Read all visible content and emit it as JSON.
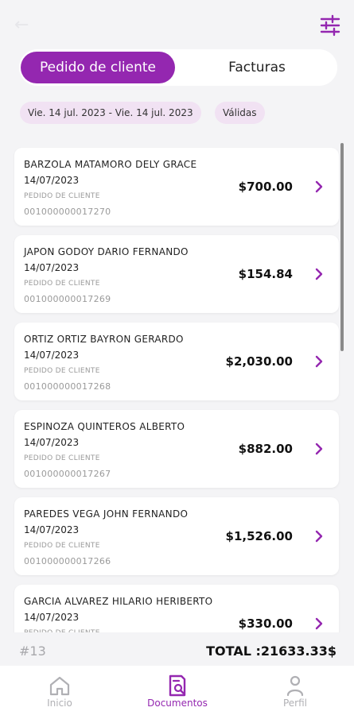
{
  "header": {
    "back_icon": "back-arrow-icon",
    "filter_icon": "sliders-icon"
  },
  "tabs": [
    {
      "label": "Pedido de cliente",
      "active": true
    },
    {
      "label": "Facturas",
      "active": false
    }
  ],
  "filters": {
    "date_range": "Vie. 14 jul. 2023 - Vie. 14 jul. 2023",
    "status": "Válidas"
  },
  "orders": [
    {
      "name": "BARZOLA MATAMORO DELY GRACE",
      "date": "14/07/2023",
      "type": "PEDIDO DE CLIENTE",
      "number": "001000000017270",
      "amount": "$700.00"
    },
    {
      "name": "JAPON GODOY DARIO FERNANDO",
      "date": "14/07/2023",
      "type": "PEDIDO DE CLIENTE",
      "number": "001000000017269",
      "amount": "$154.84"
    },
    {
      "name": "ORTIZ ORTIZ BAYRON GERARDO",
      "date": "14/07/2023",
      "type": "PEDIDO DE CLIENTE",
      "number": "001000000017268",
      "amount": "$2,030.00"
    },
    {
      "name": "ESPINOZA QUINTEROS ALBERTO",
      "date": "14/07/2023",
      "type": "PEDIDO DE CLIENTE",
      "number": "001000000017267",
      "amount": "$882.00"
    },
    {
      "name": "PAREDES VEGA JOHN FERNANDO",
      "date": "14/07/2023",
      "type": "PEDIDO DE CLIENTE",
      "number": "001000000017266",
      "amount": "$1,526.00"
    },
    {
      "name": "GARCIA ALVAREZ HILARIO HERIBERTO",
      "date": "14/07/2023",
      "type": "PEDIDO DE CLIENTE",
      "number": "",
      "amount": "$330.00"
    }
  ],
  "summary": {
    "count": "#13",
    "total": "TOTAL :21633.33$"
  },
  "nav": [
    {
      "label": "Inicio",
      "icon": "home-icon",
      "active": false
    },
    {
      "label": "Documentos",
      "icon": "document-search-icon",
      "active": true
    },
    {
      "label": "Perfil",
      "icon": "user-icon",
      "active": false
    }
  ],
  "colors": {
    "accent": "#9427b0",
    "chip_bg": "#f1e2f3",
    "background": "#f4f4f6"
  }
}
